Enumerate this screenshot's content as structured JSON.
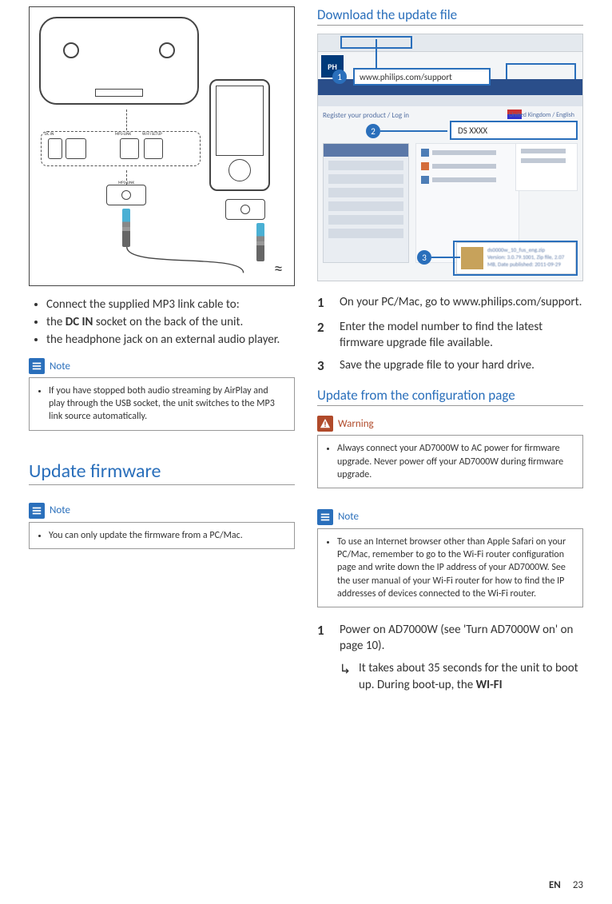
{
  "left": {
    "backpanel_labels": {
      "dc": "DC IN",
      "mp3": "MP3-LINK",
      "wifi": "WI-FI SETUP"
    },
    "jack_label": "MP3-LINK",
    "connect_intro": "Connect the supplied MP3 link cable to:",
    "connect_items": {
      "a_pre": "the ",
      "a_bold": "DC IN",
      "a_post": " socket on the back of the unit.",
      "b": "the headphone jack on an external audio player."
    },
    "note1": {
      "title": "Note",
      "text": "If you have stopped both audio streaming by AirPlay and play through the USB socket, the unit switches to the MP3 link source automatically."
    },
    "update_heading": "Update firmware",
    "note2": {
      "title": "Note",
      "text": "You can only update the firmware from a PC/Mac."
    }
  },
  "right": {
    "download_heading": "Download the update file",
    "screenshot": {
      "logo": "PH",
      "url_callout": "www.philips.com/support",
      "search_callout": "DS XXXX",
      "region_text": "United Kingdom / English",
      "register_text": "Register your product / Log in",
      "file_lines": {
        "a": "ds0000w_10_fus_eng.zip",
        "b": "Version: 3.0.79.1001, Zip file, 2.07",
        "c": "MB, Date published: 2011-09-29"
      },
      "badge1": "1",
      "badge2": "2",
      "badge3": "3"
    },
    "steps_a": {
      "s1": {
        "n": "1",
        "t": "On your PC/Mac, go to www.philips.com/support."
      },
      "s2": {
        "n": "2",
        "t": "Enter the model number to find the latest firmware upgrade file available."
      },
      "s3": {
        "n": "3",
        "t": " Save the upgrade file to your hard drive."
      }
    },
    "config_heading": "Update from the configuration page",
    "warning": {
      "title": "Warning",
      "text": "Always connect your AD7000W to AC power for firmware upgrade. Never power off your AD7000W during firmware upgrade."
    },
    "note3": {
      "title": "Note",
      "text": "To use an Internet browser other than Apple Safari on your PC/Mac, remember to go to the Wi-Fi router configuration page and write down the IP address of your AD7000W. See the user manual of your Wi-Fi router for how to find the IP addresses of devices connected to the Wi-Fi router."
    },
    "steps_b": {
      "s1": {
        "n": "1",
        "t": "Power on AD7000W (see 'Turn AD7000W on' on page 10)."
      },
      "result_pre": "It takes about 35 seconds for the unit to boot up. During boot-up, the ",
      "result_bold": "WI-FI"
    }
  },
  "footer": {
    "lang": "EN",
    "page": "23"
  }
}
